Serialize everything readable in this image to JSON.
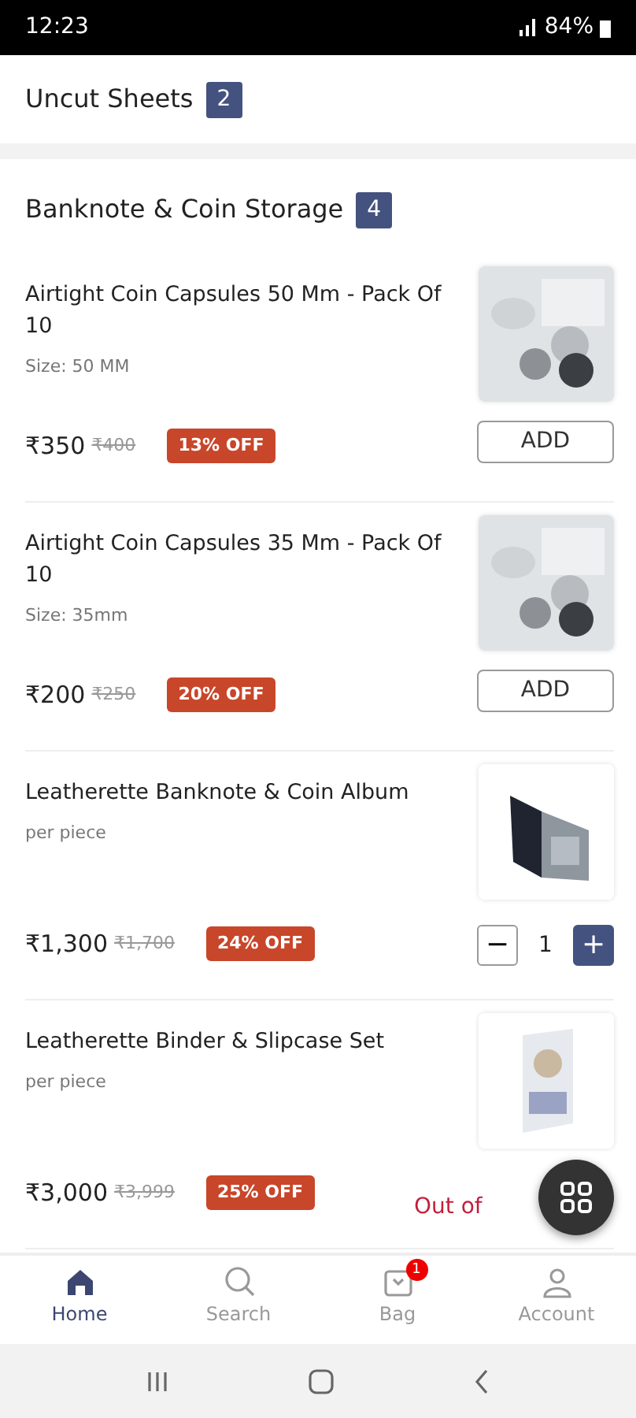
{
  "status_bar": {
    "time": "12:23",
    "battery": "84%"
  },
  "sections": [
    {
      "title": "Uncut Sheets",
      "count": "2"
    },
    {
      "title": "Banknote & Coin Storage",
      "count": "4"
    }
  ],
  "products": [
    {
      "name": "Airtight Coin Capsules 50 Mm - Pack Of 10",
      "detail": "Size: 50 MM",
      "price": "₹350",
      "mrp": "₹400",
      "discount": "13% OFF",
      "kind": "add",
      "action": "ADD"
    },
    {
      "name": "Airtight Coin Capsules 35 Mm - Pack Of 10",
      "detail": "Size: 35mm",
      "price": "₹200",
      "mrp": "₹250",
      "discount": "20% OFF",
      "kind": "add",
      "action": "ADD"
    },
    {
      "name": "Leatherette Banknote & Coin Album",
      "detail": "per piece",
      "price": "₹1,300",
      "mrp": "₹1,700",
      "discount": "24% OFF",
      "kind": "stepper",
      "minus": "−",
      "quantity": "1",
      "plus": "+"
    },
    {
      "name": "Leatherette Binder & Slipcase Set",
      "detail": "per piece",
      "price": "₹3,000",
      "mrp": "₹3,999",
      "discount": "25% OFF",
      "kind": "out_of_stock",
      "action": "Out of"
    }
  ],
  "bottom_nav": [
    {
      "label": "Home",
      "selected": true
    },
    {
      "label": "Search",
      "selected": false
    },
    {
      "label": "Bag",
      "selected": false,
      "badge": "1"
    },
    {
      "label": "Account",
      "selected": false
    }
  ]
}
